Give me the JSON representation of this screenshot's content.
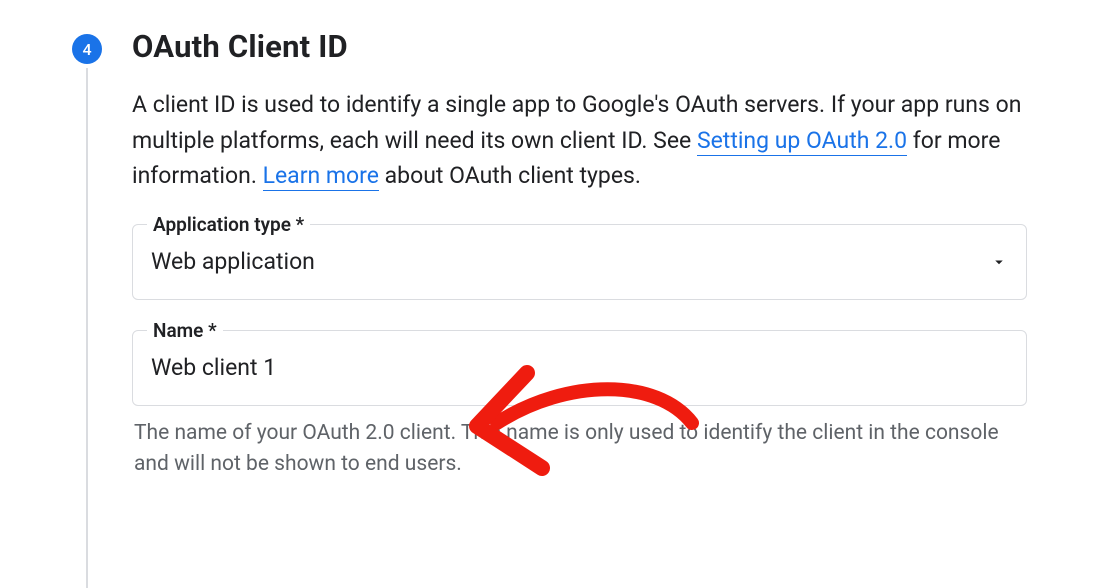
{
  "step": {
    "number": "4",
    "title": "OAuth Client ID"
  },
  "description": {
    "text1": "A client ID is used to identify a single app to Google's OAuth servers. If your app runs on multiple platforms, each will need its own client ID. See ",
    "link1": "Setting up OAuth 2.0",
    "text2": " for more information. ",
    "link2": "Learn more",
    "text3": " about OAuth client types."
  },
  "fields": {
    "applicationType": {
      "label": "Application type *",
      "value": "Web application"
    },
    "name": {
      "label": "Name *",
      "value": "Web client 1",
      "helper": "The name of your OAuth 2.0 client. This name is only used to identify the client in the console and will not be shown to end users."
    }
  }
}
